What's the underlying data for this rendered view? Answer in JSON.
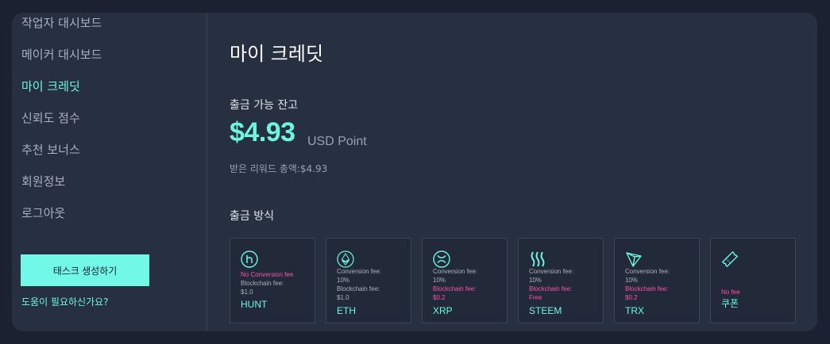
{
  "sidebar": {
    "items": [
      {
        "label": "작업자 대시보드"
      },
      {
        "label": "메이커 대시보드"
      },
      {
        "label": "마이 크레딧"
      },
      {
        "label": "신뢰도 점수"
      },
      {
        "label": "추천 보너스"
      },
      {
        "label": "회원정보"
      },
      {
        "label": "로그아웃"
      }
    ],
    "active_index": 2,
    "create_task_label": "태스크 생성하기",
    "help_label": "도움이 필요하신가요?"
  },
  "main": {
    "title": "마이 크레딧",
    "balance_label": "출금 가능 잔고",
    "balance_amount": "$4.93",
    "balance_unit": "USD Point",
    "received_label": "받은 리워드 총액:",
    "received_amount": "$4.93",
    "methods_label": "출금 방식"
  },
  "methods": [
    {
      "name": "HUNT",
      "icon": "hunt-icon",
      "lines": [
        {
          "text": "No Conversion fee",
          "pink": true
        },
        {
          "text": "Blockchain fee:",
          "pink": false
        },
        {
          "text": "$1.0",
          "pink": false
        }
      ]
    },
    {
      "name": "ETH",
      "icon": "ethereum-icon",
      "lines": [
        {
          "text": "Conversion fee:",
          "pink": false
        },
        {
          "text": "10%",
          "pink": false
        },
        {
          "text": "Blockchain fee:",
          "pink": false
        },
        {
          "text": "$1.0",
          "pink": false
        }
      ]
    },
    {
      "name": "XRP",
      "icon": "xrp-icon",
      "lines": [
        {
          "text": "Conversion fee:",
          "pink": false
        },
        {
          "text": "10%",
          "pink": false
        },
        {
          "text": "Blockchain fee:",
          "pink": true
        },
        {
          "text": "$0.2",
          "pink": true
        }
      ]
    },
    {
      "name": "STEEM",
      "icon": "steem-icon",
      "lines": [
        {
          "text": "Conversion fee:",
          "pink": false
        },
        {
          "text": "10%",
          "pink": false
        },
        {
          "text": "Blockchain fee:",
          "pink": true
        },
        {
          "text": "Free",
          "pink": true
        }
      ]
    },
    {
      "name": "TRX",
      "icon": "tron-icon",
      "lines": [
        {
          "text": "Conversion fee:",
          "pink": false
        },
        {
          "text": "10%",
          "pink": false
        },
        {
          "text": "Blockchain fee:",
          "pink": true
        },
        {
          "text": "$0.2",
          "pink": true
        }
      ]
    },
    {
      "name": "쿠폰",
      "icon": "ticket-icon",
      "lines": [
        {
          "text": "No fee",
          "pink": true
        }
      ]
    }
  ],
  "colors": {
    "accent": "#6ef5e1",
    "pink": "#ff4fa8",
    "panel": "#273041",
    "background": "#1b2130"
  }
}
